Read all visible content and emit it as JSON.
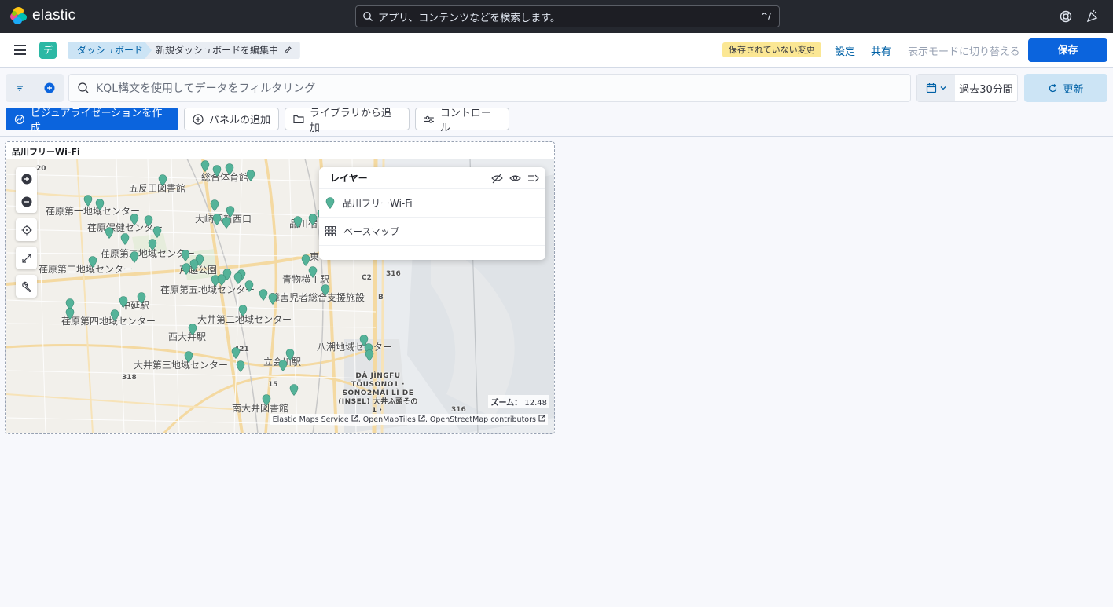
{
  "header": {
    "logo_text": "elastic",
    "search_placeholder": "アプリ、コンテンツなどを検索します。",
    "search_shortcut": "^/"
  },
  "nav": {
    "space_initial": "デ",
    "breadcrumb_root": "ダッシュボード",
    "breadcrumb_current": "新規ダッシュボードを編集中",
    "unsaved_badge": "保存されていない変更",
    "settings": "設定",
    "share": "共有",
    "view_mode": "表示モードに切り替える",
    "save": "保存"
  },
  "query": {
    "kql_placeholder": "KQL構文を使用してデータをフィルタリング",
    "time_range": "過去30分間",
    "refresh": "更新"
  },
  "toolbar": {
    "create_viz": "ビジュアライゼーションを作成",
    "add_panel": "パネルの追加",
    "add_from_library": "ライブラリから追加",
    "controls": "コントロール"
  },
  "panel": {
    "title": "品川フリーWi-Fi",
    "zoom_label": "ズーム：",
    "zoom_value": "12.48",
    "attribution": [
      "Elastic Maps Service",
      "OpenMapTiles",
      "OpenStreetMap contributors"
    ],
    "map_labels": [
      "五反田図書館",
      "総合体育館",
      "荏原第一地域センター",
      "荏原保健センター",
      "荏原第二地域センター",
      "荏原第二地域センター",
      "戸越公園",
      "荏原第五地域センター",
      "中延駅",
      "荏原第四地域センター",
      "大井第二地域センター",
      "西大井駅",
      "大井第三地域センター",
      "立会川駅",
      "南大井図書館",
      "青物横丁駅",
      "障害児者総合支援施設",
      "八潮地域センター",
      "大崎駅新西口",
      "品川宿",
      "東"
    ],
    "road_numbers": [
      "20",
      "421",
      "318",
      "15",
      "316",
      "316",
      "C2",
      "B"
    ],
    "island_label": "DÀ JÌNGFU TŌUSONO1 · SONO2MÁI LÌ DE (INSEL) 大井ふ頭その1・",
    "layers": {
      "title": "レイヤー",
      "items": [
        {
          "name": "品川フリーWi-Fi",
          "icon": "map-pin-icon"
        },
        {
          "name": "ベースマップ",
          "icon": "grid-icon"
        }
      ]
    }
  },
  "colors": {
    "accent": "#0b64dd",
    "pin": "#54b399",
    "header_bg": "#25282f",
    "unsaved_bg": "#fbe794"
  }
}
